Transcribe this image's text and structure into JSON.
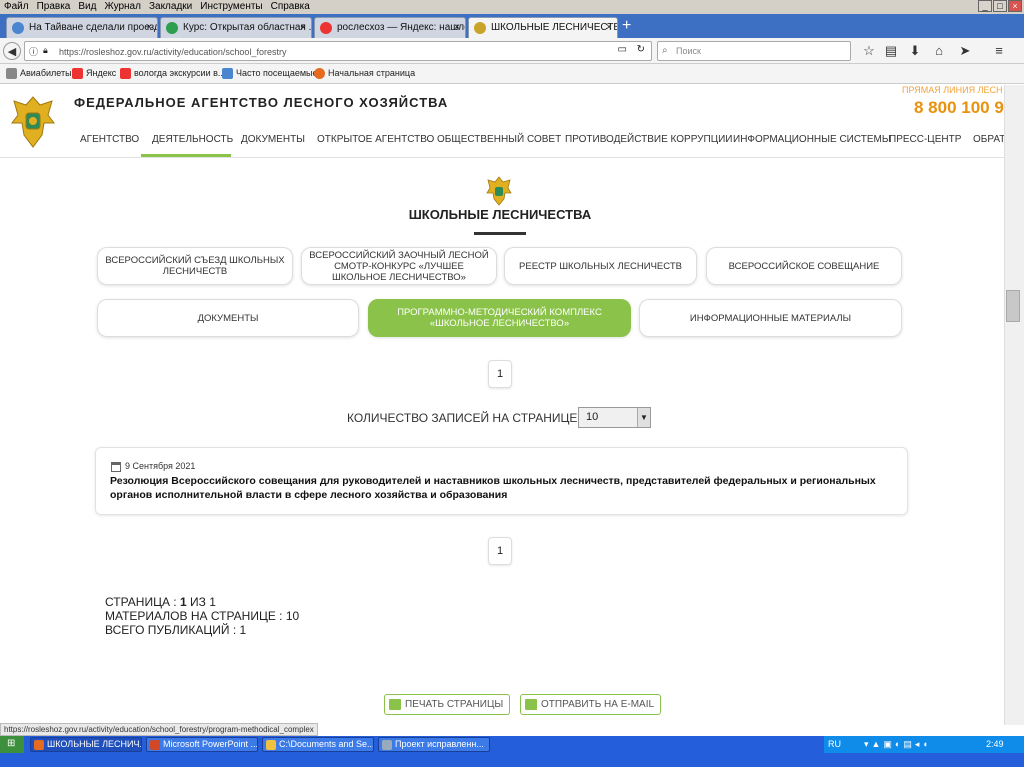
{
  "browser": {
    "menu": [
      "Файл",
      "Правка",
      "Вид",
      "Журнал",
      "Закладки",
      "Инструменты",
      "Справка"
    ],
    "tabs": [
      {
        "label": "На Тайване сделали проезд...",
        "icon_color": "#4a86d0"
      },
      {
        "label": "Курс: Открытая областная ...",
        "icon_color": "#2e9e4f"
      },
      {
        "label": "рослесхоз — Яндекс: нашло...",
        "icon_color": "#e33"
      },
      {
        "label": "ШКОЛЬНЫЕ ЛЕСНИЧЕСТВА - ...",
        "icon_color": "#c9a42a"
      }
    ],
    "new_tab": "+",
    "url": "https://rosleshoz.gov.ru/activity/education/school_forestry",
    "search_placeholder": "Поиск",
    "bookmarks": [
      "Авиабилеты",
      "Яндекс",
      "вологда экскурсии в...",
      "Часто посещаемые",
      "Начальная страница"
    ],
    "status_url": "https://rosleshoz.gov.ru/activity/education/school_forestry/program-methodical_complex"
  },
  "site": {
    "agency_name": "ФЕДЕРАЛЬНОЕ АГЕНТСТВО ЛЕСНОГО ХОЗЯЙСТВА",
    "hotline_label": "ПРЯМАЯ ЛИНИЯ ЛЕСН",
    "hotline_number": "8 800 100 9",
    "nav": [
      "АГЕНТСТВО",
      "ДЕЯТЕЛЬНОСТЬ",
      "ДОКУМЕНТЫ",
      "ОТКРЫТОЕ АГЕНТСТВО",
      "ОБЩЕСТВЕННЫЙ СОВЕТ",
      "ПРОТИВОДЕЙСТВИЕ КОРРУПЦИИ",
      "ИНФОРМАЦИОННЫЕ СИСТЕМЫ",
      "ПРЕСС-ЦЕНТР",
      "ОБРАТ"
    ],
    "active_nav": "ДЕЯТЕЛЬНОСТЬ",
    "page_title": "ШКОЛЬНЫЕ ЛЕСНИЧЕСТВА",
    "sections_row1": [
      "ВСЕРОССИЙСКИЙ СЪЕЗД ШКОЛЬНЫХ ЛЕСНИЧЕСТВ",
      "ВСЕРОССИЙСКИЙ ЗАОЧНЫЙ ЛЕСНОЙ СМОТР-КОНКУРС «ЛУЧШЕЕ ШКОЛЬНОЕ ЛЕСНИЧЕСТВО»",
      "РЕЕСТР ШКОЛЬНЫХ ЛЕСНИЧЕСТВ",
      "ВСЕРОССИЙСКОЕ СОВЕЩАНИЕ"
    ],
    "sections_row2": [
      "ДОКУМЕНТЫ",
      "ПРОГРАММНО-МЕТОДИЧЕСКИЙ КОМПЛЕКС «ШКОЛЬНОЕ ЛЕСНИЧЕСТВО»",
      "ИНФОРМАЦИОННЫЕ МАТЕРИАЛЫ"
    ],
    "active_section": "ПРОГРАММНО-МЕТОДИЧЕСКИЙ КОМПЛЕКС «ШКОЛЬНОЕ ЛЕСНИЧЕСТВО»",
    "page_number": "1",
    "per_page_label": "КОЛИЧЕСТВО ЗАПИСЕЙ НА СТРАНИЦЕ",
    "per_page_value": "10",
    "item": {
      "date": "9 Сентября 2021",
      "title": "Резолюция Всероссийского совещания для руководителей и наставников школьных лесничеств, представителей федеральных и региональных органов исполнительной власти в сфере лесного хозяйства и образования"
    },
    "stats": {
      "page_prefix": "СТРАНИЦА : ",
      "page_current": "1",
      "page_suffix": " ИЗ 1",
      "per_page_line": "МАТЕРИАЛОВ НА СТРАНИЦЕ : 10",
      "total_line": "ВСЕГО ПУБЛИКАЦИЙ : 1"
    },
    "print_label": "ПЕЧАТЬ СТРАНИЦЫ",
    "email_label": "ОТПРАВИТЬ НА E-MAIL"
  },
  "taskbar": {
    "items": [
      "ШКОЛЬНЫЕ ЛЕСНИЧ...",
      "Microsoft PowerPoint ...",
      "C:\\Documents and Se...",
      "Проект исправленн..."
    ],
    "language": "RU",
    "time": "2:49"
  }
}
